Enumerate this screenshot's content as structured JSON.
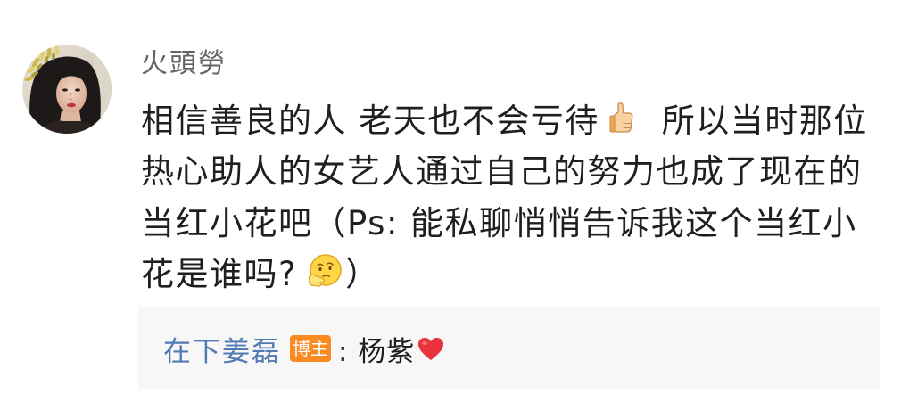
{
  "comment": {
    "username": "火頭勞",
    "lines": [
      {
        "text": "相信善良的人 老天也不会亏待",
        "emoji": "thumbs-up-icon",
        "after": "所以当时那位"
      },
      {
        "text": "热心助人的女艺人通过自己的努力也成了现在的"
      },
      {
        "text": "当红小花吧（Ps: 能私聊悄悄告诉我这个当红小"
      },
      {
        "text": "花是谁吗?",
        "emoji": "thinking-face-icon",
        "after": "）"
      }
    ]
  },
  "reply": {
    "author": "在下姜磊",
    "badge": "博主",
    "text": ": 杨紫",
    "emoji": "heart-icon"
  },
  "icons": {
    "avatar": "user-avatar-photo"
  },
  "colors": {
    "text": "#1f1f1f",
    "username": "#636363",
    "reply_author": "#5179b4",
    "reply_bg": "#f7f7f7",
    "badge_bg": "#fa8a22",
    "badge_text": "#ffffff",
    "heart": "#e8323c"
  }
}
